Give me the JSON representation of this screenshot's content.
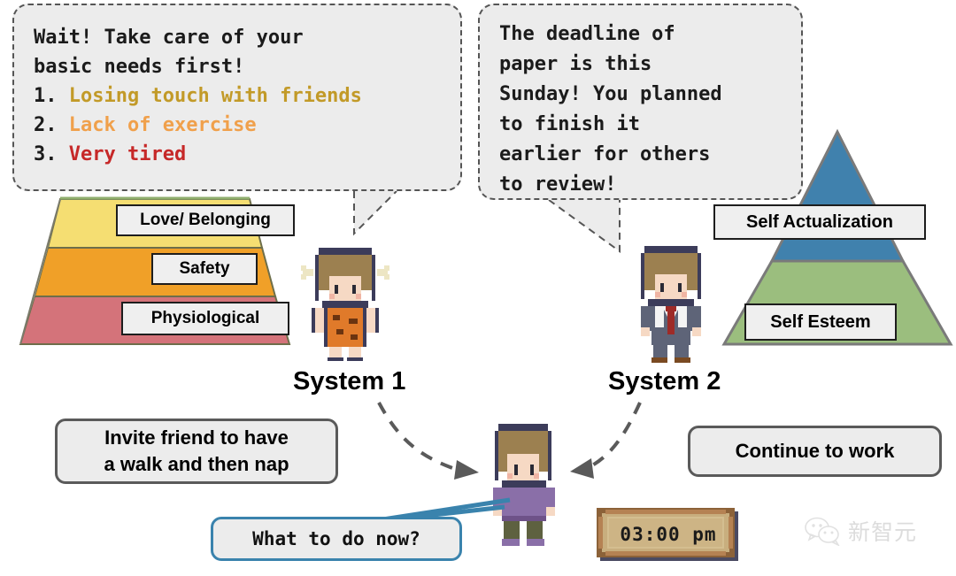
{
  "bubbles": {
    "system1": {
      "heading_line1": "Wait! Take care of your",
      "heading_line2": "basic needs first!",
      "items": [
        {
          "num": "1.",
          "text": "Losing touch with friends",
          "color": "#C29A28"
        },
        {
          "num": "2.",
          "text": "Lack of exercise",
          "color": "#F0A04B"
        },
        {
          "num": "3.",
          "text": "Very tired",
          "color": "#C62828"
        }
      ]
    },
    "system2": {
      "line1": "The deadline of",
      "line2": "paper is this",
      "line3": "Sunday! You planned",
      "line4": "to finish it",
      "line5": "earlier for others",
      "line6": "to review!"
    }
  },
  "pyramid_left": {
    "name": "maslow-lower-needs",
    "tiers": [
      {
        "label": "Love/ Belonging",
        "color": "#F5DE72"
      },
      {
        "label": "Safety",
        "color": "#F0A028"
      },
      {
        "label": "Physiological",
        "color": "#D4737A"
      }
    ]
  },
  "pyramid_right": {
    "name": "maslow-higher-needs",
    "tiers": [
      {
        "label": "Self Actualization",
        "color": "#4081AD"
      },
      {
        "label": "Self Esteem",
        "color": "#9BBE7E"
      }
    ]
  },
  "captions": {
    "system1": "System 1",
    "system2": "System 2"
  },
  "actions": {
    "left_line1": "Invite friend to have",
    "left_line2": "a walk and then nap",
    "right": "Continue to work"
  },
  "callout": {
    "question": "What to do now?",
    "border_color": "#3A83AD"
  },
  "clock": {
    "time": "03:00 pm"
  },
  "watermark": {
    "text": "新智元",
    "icon": "wechat-icon"
  },
  "characters": {
    "system1": "caveman-avatar",
    "system2": "businessman-avatar",
    "center": "decider-avatar"
  },
  "arrows": {
    "from_system1": "dashed-curved-arrow",
    "from_system2": "dashed-curved-arrow"
  }
}
